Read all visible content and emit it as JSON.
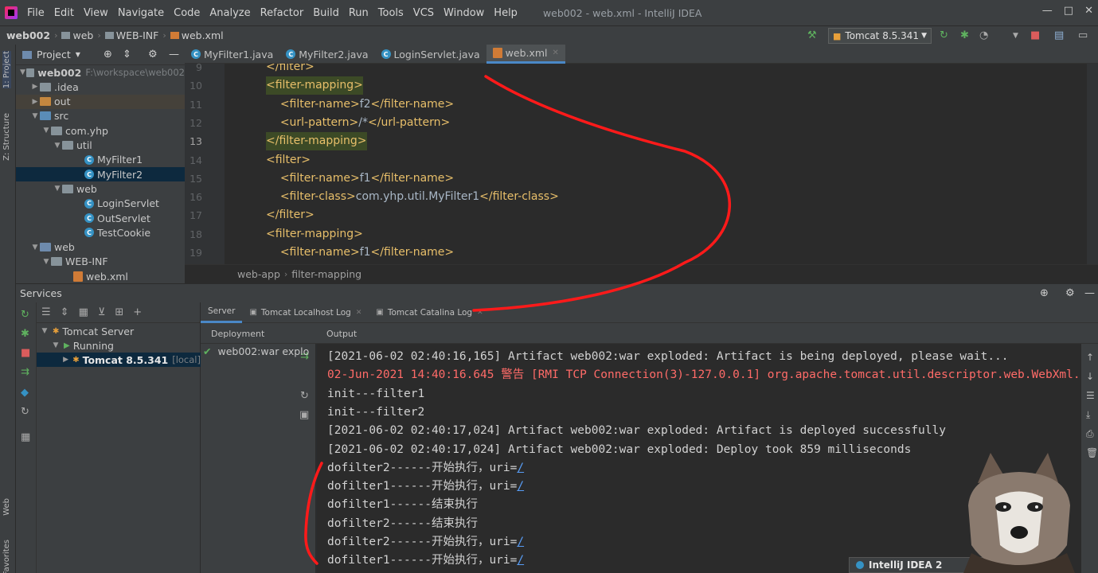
{
  "window": {
    "title": "web002 - web.xml - IntelliJ IDEA",
    "menu": [
      "File",
      "Edit",
      "View",
      "Navigate",
      "Code",
      "Analyze",
      "Refactor",
      "Build",
      "Run",
      "Tools",
      "VCS",
      "Window",
      "Help"
    ]
  },
  "breadcrumb": [
    "web002",
    "web",
    "WEB-INF",
    "web.xml"
  ],
  "run_config": "Tomcat 8.5.341",
  "side_tabs": {
    "project": "1: Project",
    "structure": "Z: Structure",
    "web": "Web",
    "favorites": "Favorites"
  },
  "project": {
    "header": "Project",
    "root_path": "F:\\workspace\\web002",
    "tree": [
      {
        "label": "web002",
        "kind": "module"
      },
      {
        "label": ".idea",
        "kind": "folder"
      },
      {
        "label": "out",
        "kind": "folder-orange"
      },
      {
        "label": "src",
        "kind": "folder-src"
      },
      {
        "label": "com.yhp",
        "kind": "package"
      },
      {
        "label": "util",
        "kind": "package"
      },
      {
        "label": "MyFilter1",
        "kind": "class"
      },
      {
        "label": "MyFilter2",
        "kind": "class"
      },
      {
        "label": "web",
        "kind": "package"
      },
      {
        "label": "LoginServlet",
        "kind": "class"
      },
      {
        "label": "OutServlet",
        "kind": "class"
      },
      {
        "label": "TestCookie",
        "kind": "class"
      },
      {
        "label": "web",
        "kind": "folder-web"
      },
      {
        "label": "WEB-INF",
        "kind": "folder"
      },
      {
        "label": "web.xml",
        "kind": "xml"
      }
    ]
  },
  "editor": {
    "tabs": [
      "MyFilter1.java",
      "MyFilter2.java",
      "LoginServlet.java",
      "web.xml"
    ],
    "active_tab": "web.xml",
    "current_line": 13,
    "lines": [
      {
        "num": "9",
        "indent": "",
        "open": "</filter>",
        "text": "",
        "close": ""
      },
      {
        "num": "10",
        "indent": "",
        "open": "<filter-mapping>",
        "text": "",
        "close": ""
      },
      {
        "num": "11",
        "indent": "    ",
        "open": "<filter-name>",
        "text": "f2",
        "close": "</filter-name>"
      },
      {
        "num": "12",
        "indent": "    ",
        "open": "<url-pattern>",
        "text": "/*",
        "close": "</url-pattern>"
      },
      {
        "num": "13",
        "indent": "",
        "open": "</filter-mapping>",
        "text": "",
        "close": ""
      },
      {
        "num": "14",
        "indent": "",
        "open": "<filter>",
        "text": "",
        "close": ""
      },
      {
        "num": "15",
        "indent": "    ",
        "open": "<filter-name>",
        "text": "f1",
        "close": "</filter-name>"
      },
      {
        "num": "16",
        "indent": "    ",
        "open": "<filter-class>",
        "text": "com.yhp.util.MyFilter1",
        "close": "</filter-class>"
      },
      {
        "num": "17",
        "indent": "",
        "open": "</filter>",
        "text": "",
        "close": ""
      },
      {
        "num": "18",
        "indent": "",
        "open": "<filter-mapping>",
        "text": "",
        "close": ""
      },
      {
        "num": "19",
        "indent": "    ",
        "open": "<filter-name>",
        "text": "f1",
        "close": "</filter-name>"
      }
    ],
    "breadcrumb": [
      "web-app",
      "filter-mapping"
    ]
  },
  "services": {
    "title": "Services",
    "tree": {
      "server": "Tomcat Server",
      "status": "Running",
      "instance": "Tomcat 8.5.341",
      "instance_tag": "[local]"
    },
    "subtabs": [
      "Server",
      "Tomcat Localhost Log",
      "Tomcat Catalina Log"
    ],
    "deployment_header": "Deployment",
    "output_header": "Output",
    "deployment_item": "web002:war explo",
    "console": [
      {
        "text": "[2021-06-02 02:40:16,165] Artifact web002:war exploded: Artifact is being deployed, please wait...",
        "type": "info"
      },
      {
        "text": "02-Jun-2021 14:40:16.645 警告 [RMI TCP Connection(3)-127.0.0.1] org.apache.tomcat.util.descriptor.web.WebXml.",
        "type": "warn"
      },
      {
        "text": "init---filter1",
        "type": "info"
      },
      {
        "text": "init---filter2",
        "type": "info"
      },
      {
        "text": "[2021-06-02 02:40:17,024] Artifact web002:war exploded: Artifact is deployed successfully",
        "type": "info"
      },
      {
        "text": "[2021-06-02 02:40:17,024] Artifact web002:war exploded: Deploy took 859 milliseconds",
        "type": "info"
      },
      {
        "text": "dofilter2------开始执行，uri=",
        "type": "uri",
        "link": "/"
      },
      {
        "text": "dofilter1------开始执行，uri=",
        "type": "uri",
        "link": "/"
      },
      {
        "text": "dofilter1------结束执行",
        "type": "info"
      },
      {
        "text": "dofilter2------结束执行",
        "type": "info"
      },
      {
        "text": "dofilter2------开始执行，uri=",
        "type": "uri",
        "link": "/"
      },
      {
        "text": "dofilter1------开始执行，uri=",
        "type": "uri",
        "link": "/"
      }
    ]
  },
  "notification": "IntelliJ IDEA 2",
  "colors": {
    "accent": "#4a88c7",
    "tag": "#e8bf6a",
    "warn": "#ff6b68",
    "link": "#589df6",
    "annotation": "#ff1a1a"
  }
}
